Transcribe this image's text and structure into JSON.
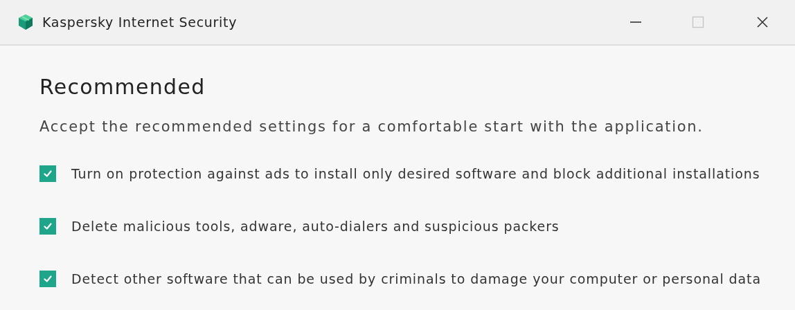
{
  "window": {
    "title": "Kaspersky Internet Security"
  },
  "heading": "Recommended",
  "description": "Accept the recommended settings for a comfortable start with the application.",
  "options": [
    {
      "label": "Turn on protection against ads to install only desired software and block additional installations",
      "checked": true
    },
    {
      "label": "Delete malicious tools, adware, auto-dialers and suspicious packers",
      "checked": true
    },
    {
      "label": "Detect other software that can be used by criminals to damage your computer or personal data",
      "checked": true
    }
  ]
}
